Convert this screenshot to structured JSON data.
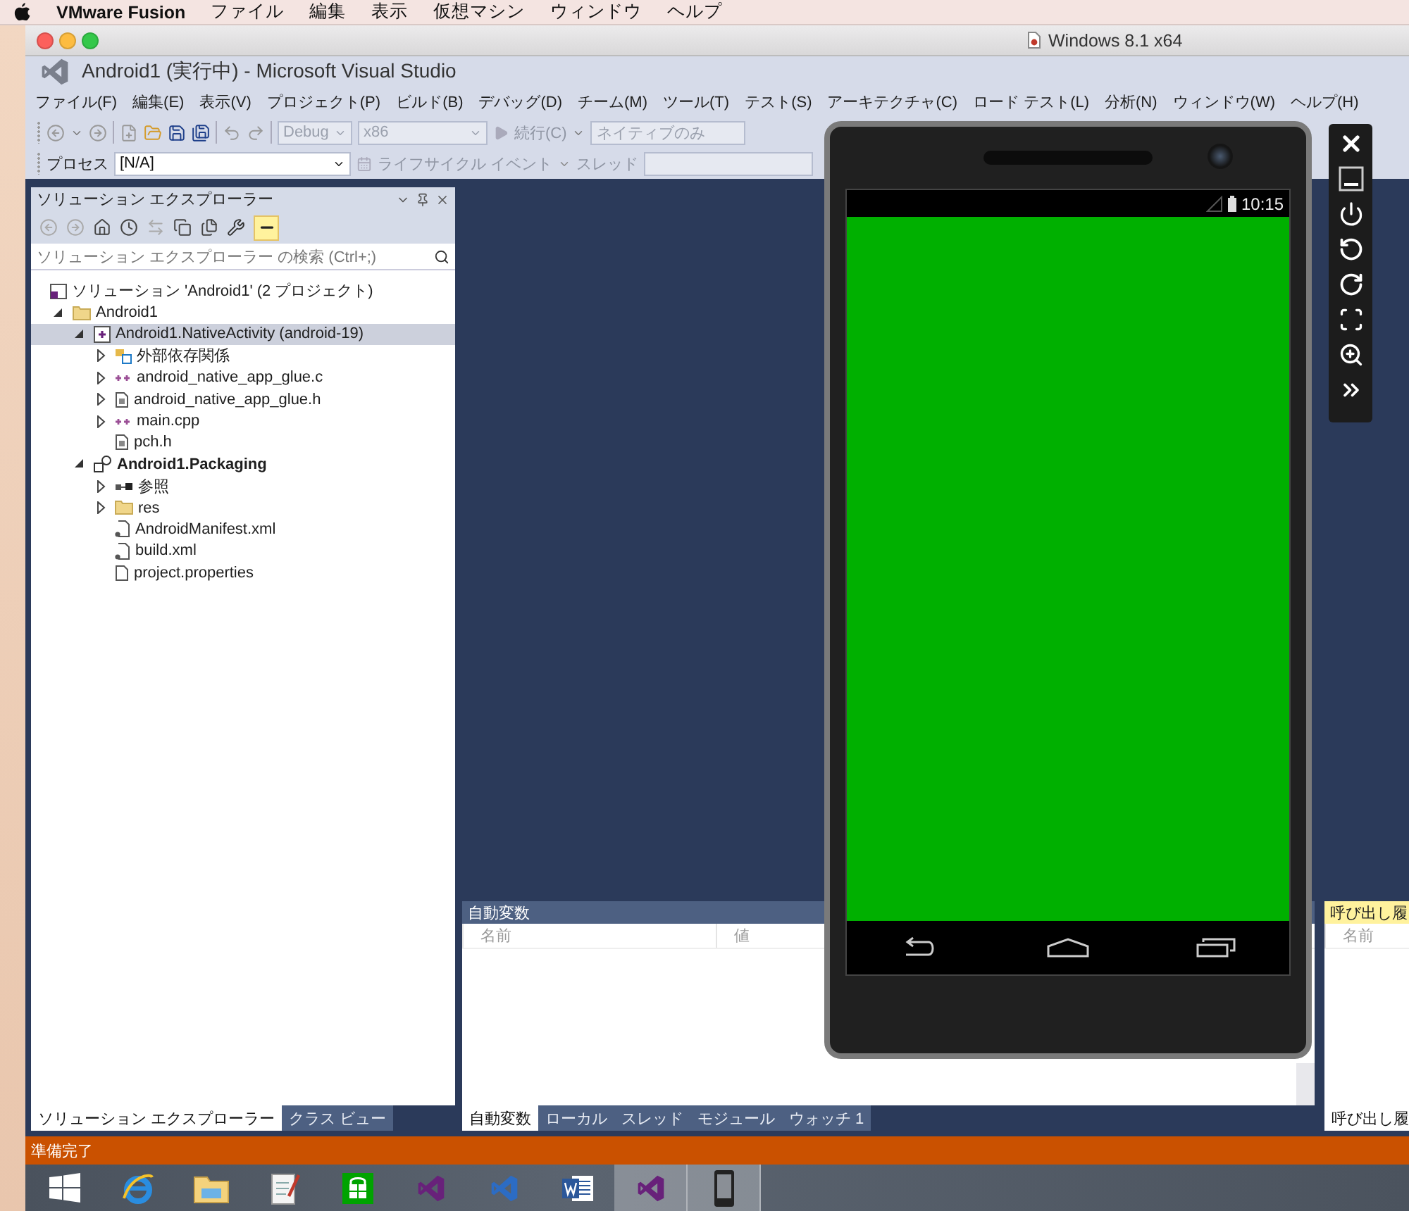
{
  "mac_menubar": {
    "app": "VMware Fusion",
    "items": [
      "ファイル",
      "編集",
      "表示",
      "仮想マシン",
      "ウィンドウ",
      "ヘルプ"
    ]
  },
  "vm_window": {
    "title": "Windows 8.1 x64"
  },
  "vs": {
    "title": "Android1 (実行中) - Microsoft Visual Studio",
    "menu": [
      "ファイル(F)",
      "編集(E)",
      "表示(V)",
      "プロジェクト(P)",
      "ビルド(B)",
      "デバッグ(D)",
      "チーム(M)",
      "ツール(T)",
      "テスト(S)",
      "アーキテクチャ(C)",
      "ロード テスト(L)",
      "分析(N)",
      "ウィンドウ(W)",
      "ヘルプ(H)"
    ],
    "toolbar": {
      "configuration": "Debug",
      "platform": "x86",
      "continue": "続行(C)",
      "debugger": "ネイティブのみ"
    },
    "process_bar": {
      "label": "プロセス",
      "process": "[N/A]",
      "lifecycle": "ライフサイクル イベント",
      "thread_label": "スレッド"
    }
  },
  "solution_explorer": {
    "title": "ソリューション エクスプローラー",
    "preview_on": true,
    "search": {
      "placeholder": "ソリューション エクスプローラー の検索 (Ctrl+;)"
    },
    "tree": [
      {
        "label": "ソリューション 'Android1' (2 プロジェクト)",
        "kind": "solution",
        "selected": false,
        "children": [
          {
            "label": "Android1",
            "kind": "folder",
            "selected": false,
            "expanded": true,
            "children": [
              {
                "label": "Android1.NativeActivity (android-19)",
                "kind": "project",
                "selected": true,
                "expanded": true,
                "children": [
                  {
                    "label": "外部依存関係",
                    "kind": "deps",
                    "selected": false,
                    "expanded": false
                  },
                  {
                    "label": "android_native_app_glue.c",
                    "kind": "source",
                    "selected": false,
                    "expanded": false
                  },
                  {
                    "label": "android_native_app_glue.h",
                    "kind": "header",
                    "selected": false,
                    "expanded": false
                  },
                  {
                    "label": "main.cpp",
                    "kind": "source",
                    "selected": false,
                    "expanded": false
                  },
                  {
                    "label": "pch.h",
                    "kind": "header",
                    "selected": false
                  }
                ]
              },
              {
                "label": "Android1.Packaging",
                "kind": "packaging",
                "bold": true,
                "selected": false,
                "expanded": true,
                "children": [
                  {
                    "label": "参照",
                    "kind": "refs",
                    "selected": false,
                    "expanded": false
                  },
                  {
                    "label": "res",
                    "kind": "folder",
                    "selected": false,
                    "expanded": false
                  },
                  {
                    "label": "AndroidManifest.xml",
                    "kind": "xml",
                    "selected": false
                  },
                  {
                    "label": "build.xml",
                    "kind": "xml",
                    "selected": false
                  },
                  {
                    "label": "project.properties",
                    "kind": "file",
                    "selected": false
                  }
                ]
              }
            ]
          }
        ]
      }
    ],
    "tabs": [
      {
        "label": "ソリューション エクスプローラー",
        "selected": true
      },
      {
        "label": "クラス ビュー",
        "selected": false
      }
    ]
  },
  "autos_panel": {
    "title": "自動変数",
    "columns": [
      "名前",
      "値"
    ],
    "tabs": [
      {
        "label": "自動変数",
        "selected": true
      },
      {
        "label": "ローカル",
        "selected": false
      },
      {
        "label": "スレッド",
        "selected": false
      },
      {
        "label": "モジュール",
        "selected": false
      },
      {
        "label": "ウォッチ 1",
        "selected": false
      }
    ]
  },
  "call_stack_panel": {
    "title": "呼び出し履",
    "columns": [
      "名前"
    ],
    "tabs": [
      {
        "label": "呼び出し履",
        "selected": true
      }
    ]
  },
  "status_bar": {
    "text": "準備完了"
  },
  "emulator": {
    "time": "10:15"
  },
  "taskbar": [
    {
      "kind": "start",
      "selected": false
    },
    {
      "kind": "browser",
      "selected": false
    },
    {
      "kind": "explorer",
      "selected": false
    },
    {
      "kind": "notepad",
      "selected": false
    },
    {
      "kind": "store",
      "selected": false
    },
    {
      "kind": "vs_purple",
      "selected": false
    },
    {
      "kind": "vs_blue",
      "selected": false
    },
    {
      "kind": "word",
      "selected": false
    },
    {
      "kind": "vs_purple",
      "selected": true
    },
    {
      "kind": "phone",
      "selected": true
    }
  ]
}
